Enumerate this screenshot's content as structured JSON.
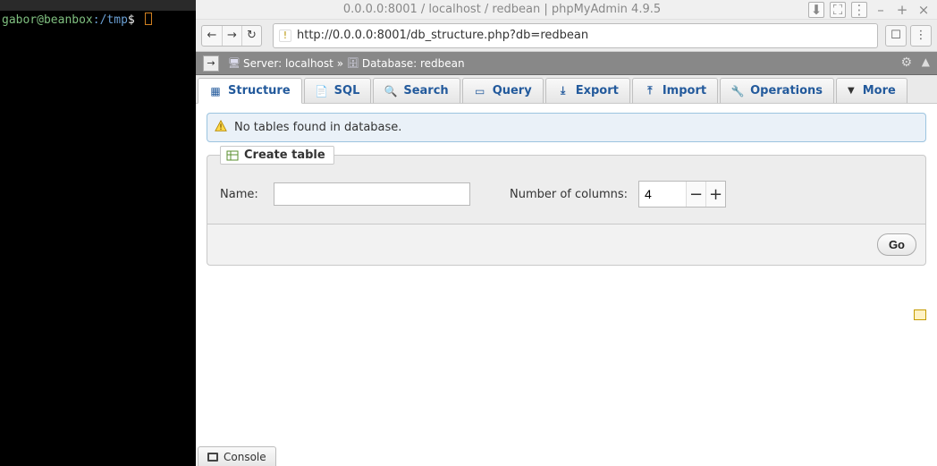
{
  "terminal": {
    "user": "gabor",
    "host": "beanbox",
    "path": "/tmp",
    "prompt_symbol": "$"
  },
  "window": {
    "title": "0.0.0.0:8001 / localhost / redbean | phpMyAdmin 4.9.5"
  },
  "browser": {
    "url": "http://0.0.0.0:8001/db_structure.php?db=redbean"
  },
  "breadcrumb": {
    "server_label": "Server:",
    "server": "localhost",
    "sep": "»",
    "database_label": "Database:",
    "database": "redbean"
  },
  "tabs": [
    {
      "label": "Structure",
      "icon": "structure-icon"
    },
    {
      "label": "SQL",
      "icon": "sql-icon"
    },
    {
      "label": "Search",
      "icon": "search-icon"
    },
    {
      "label": "Query",
      "icon": "query-icon"
    },
    {
      "label": "Export",
      "icon": "export-icon"
    },
    {
      "label": "Import",
      "icon": "import-icon"
    },
    {
      "label": "Operations",
      "icon": "operations-icon"
    },
    {
      "label": "More",
      "icon": "more-icon"
    }
  ],
  "notice": {
    "text": "No tables found in database."
  },
  "create_table": {
    "legend": "Create table",
    "name_label": "Name:",
    "name_value": "",
    "columns_label": "Number of columns:",
    "columns_value": "4",
    "go_label": "Go"
  },
  "console": {
    "label": "Console"
  }
}
